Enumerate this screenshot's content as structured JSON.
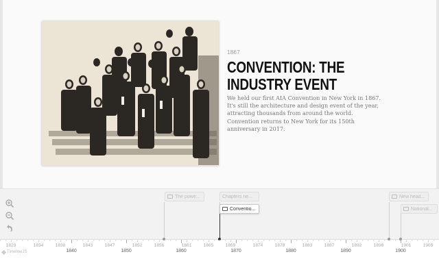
{
  "slide": {
    "date": "1867",
    "headline_line1": "CONVENTION: THE",
    "headline_line2": "INDUSTRY EVENT",
    "body_lines": [
      "We held our first AIA Convention in New York in 1867.",
      "It's still the architecture and design event of the year,",
      "attracting thousands from around the world.",
      "Convention returns to New York for its 150th",
      "anniversary in 2017."
    ],
    "photo_icon": "group-photo"
  },
  "timeline": {
    "controls": {
      "zoom_in_icon": "zoom-in-icon",
      "zoom_out_icon": "zoom-out-icon",
      "back_icon": "back-to-start-icon"
    },
    "markers": [
      {
        "label": "The powe...",
        "active": false
      },
      {
        "label": "Chapters ne...",
        "active": false
      },
      {
        "label": "Conventio...",
        "active": true
      },
      {
        "label": "New head...",
        "active": false
      },
      {
        "label": "National...",
        "active": false
      }
    ],
    "minor_ticks": [
      "1829",
      "1834",
      "1838",
      "1843",
      "1847",
      "1852",
      "1856",
      "1861",
      "1865",
      "1869",
      "1874",
      "1878",
      "1883",
      "1887",
      "1892",
      "1896",
      "1901",
      "1905"
    ],
    "major_ticks": [
      "1840",
      "1850",
      "1860",
      "1870",
      "1880",
      "1890",
      "1900"
    ],
    "brand": "TimelineJS"
  }
}
